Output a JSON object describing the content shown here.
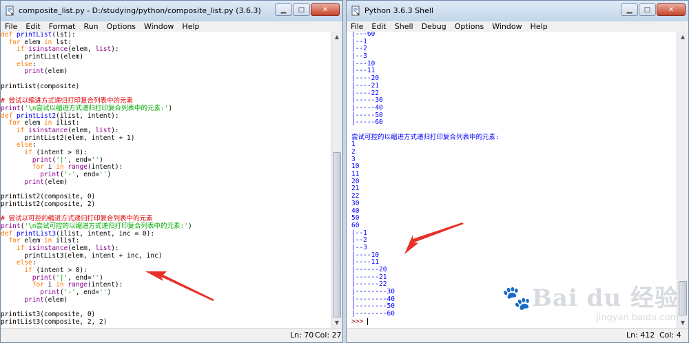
{
  "left_window": {
    "title": "composite_list.py - D:/studying/python/composite_list.py (3.6.3)",
    "menu": [
      "File",
      "Edit",
      "Format",
      "Run",
      "Options",
      "Window",
      "Help"
    ],
    "code_lines": [
      [
        [
          "kw",
          "def "
        ],
        [
          "def",
          "printList"
        ],
        [
          "",
          "(lst):"
        ]
      ],
      [
        [
          "",
          "  "
        ],
        [
          "kw",
          "for"
        ],
        [
          "",
          " elem "
        ],
        [
          "kw",
          "in"
        ],
        [
          "",
          " lst:"
        ]
      ],
      [
        [
          "",
          "    "
        ],
        [
          "kw",
          "if "
        ],
        [
          "bi",
          "isinstance"
        ],
        [
          "",
          "(elem, "
        ],
        [
          "bi",
          "list"
        ],
        [
          "",
          "):"
        ]
      ],
      [
        [
          "",
          "      printList(elem)"
        ]
      ],
      [
        [
          "",
          "    "
        ],
        [
          "kw",
          "else"
        ],
        [
          "",
          ":"
        ]
      ],
      [
        [
          "",
          "      "
        ],
        [
          "bi",
          "print"
        ],
        [
          "",
          "(elem)"
        ]
      ],
      [
        [
          "",
          ""
        ]
      ],
      [
        [
          "",
          "printList(composite)"
        ]
      ],
      [
        [
          "",
          ""
        ]
      ],
      [
        [
          "cm",
          "# 尝试以缩进方式递归打印复合列表中的元素"
        ]
      ],
      [
        [
          "bi",
          "print"
        ],
        [
          "",
          "("
        ],
        [
          "st",
          "'\\n尝试以缩进方式递归打印复合列表中的元素:'"
        ],
        [
          "",
          ")"
        ]
      ],
      [
        [
          "kw",
          "def "
        ],
        [
          "def",
          "printList2"
        ],
        [
          "",
          "(ilist, intent):"
        ]
      ],
      [
        [
          "",
          "  "
        ],
        [
          "kw",
          "for"
        ],
        [
          "",
          " elem "
        ],
        [
          "kw",
          "in"
        ],
        [
          "",
          " ilist:"
        ]
      ],
      [
        [
          "",
          "    "
        ],
        [
          "kw",
          "if "
        ],
        [
          "bi",
          "isinstance"
        ],
        [
          "",
          "(elem, "
        ],
        [
          "bi",
          "list"
        ],
        [
          "",
          "):"
        ]
      ],
      [
        [
          "",
          "      printList2(elem, intent + 1)"
        ]
      ],
      [
        [
          "",
          "    "
        ],
        [
          "kw",
          "else"
        ],
        [
          "",
          ":"
        ]
      ],
      [
        [
          "",
          "      "
        ],
        [
          "kw",
          "if"
        ],
        [
          "",
          " (intent > 0):"
        ]
      ],
      [
        [
          "",
          "        "
        ],
        [
          "bi",
          "print"
        ],
        [
          "",
          "("
        ],
        [
          "st",
          "'|'"
        ],
        [
          "",
          ", end="
        ],
        [
          "st",
          "''"
        ],
        [
          "",
          ")"
        ]
      ],
      [
        [
          "",
          "        "
        ],
        [
          "kw",
          "for"
        ],
        [
          "",
          " i "
        ],
        [
          "kw",
          "in "
        ],
        [
          "bi",
          "range"
        ],
        [
          "",
          "(intent):"
        ]
      ],
      [
        [
          "",
          "          "
        ],
        [
          "bi",
          "print"
        ],
        [
          "",
          "("
        ],
        [
          "st",
          "'-'"
        ],
        [
          "",
          ", end="
        ],
        [
          "st",
          "''"
        ],
        [
          "",
          ")"
        ]
      ],
      [
        [
          "",
          "      "
        ],
        [
          "bi",
          "print"
        ],
        [
          "",
          "(elem)"
        ]
      ],
      [
        [
          "",
          ""
        ]
      ],
      [
        [
          "",
          "printList2(composite, 0)"
        ]
      ],
      [
        [
          "",
          "printList2(composite, 2)"
        ]
      ],
      [
        [
          "",
          ""
        ]
      ],
      [
        [
          "cm",
          "# 尝试以可控的缩进方式递归打印复合列表中的元素"
        ]
      ],
      [
        [
          "bi",
          "print"
        ],
        [
          "",
          "("
        ],
        [
          "st",
          "'\\n尝试可控的以缩进方式递归打印复合列表中的元素:'"
        ],
        [
          "",
          ")"
        ]
      ],
      [
        [
          "kw",
          "def "
        ],
        [
          "def",
          "printList3"
        ],
        [
          "",
          "(ilist, intent, inc = 0):"
        ]
      ],
      [
        [
          "",
          "  "
        ],
        [
          "kw",
          "for"
        ],
        [
          "",
          " elem "
        ],
        [
          "kw",
          "in"
        ],
        [
          "",
          " ilist:"
        ]
      ],
      [
        [
          "",
          "    "
        ],
        [
          "kw",
          "if "
        ],
        [
          "bi",
          "isinstance"
        ],
        [
          "",
          "(elem, "
        ],
        [
          "bi",
          "list"
        ],
        [
          "",
          "):"
        ]
      ],
      [
        [
          "",
          "      printList3(elem, intent + inc, inc)"
        ]
      ],
      [
        [
          "",
          "    "
        ],
        [
          "kw",
          "else"
        ],
        [
          "",
          ":"
        ]
      ],
      [
        [
          "",
          "      "
        ],
        [
          "kw",
          "if"
        ],
        [
          "",
          " (intent > 0):"
        ]
      ],
      [
        [
          "",
          "        "
        ],
        [
          "bi",
          "print"
        ],
        [
          "",
          "("
        ],
        [
          "st",
          "'|'"
        ],
        [
          "",
          ", end="
        ],
        [
          "st",
          "''"
        ],
        [
          "",
          ")"
        ]
      ],
      [
        [
          "",
          "        "
        ],
        [
          "kw",
          "for"
        ],
        [
          "",
          " i "
        ],
        [
          "kw",
          "in "
        ],
        [
          "bi",
          "range"
        ],
        [
          "",
          "(intent):"
        ]
      ],
      [
        [
          "",
          "          "
        ],
        [
          "bi",
          "print"
        ],
        [
          "",
          "("
        ],
        [
          "st",
          "'-'"
        ],
        [
          "",
          ", end="
        ],
        [
          "st",
          "''"
        ],
        [
          "",
          ")"
        ]
      ],
      [
        [
          "",
          "      "
        ],
        [
          "bi",
          "print"
        ],
        [
          "",
          "(elem)"
        ]
      ],
      [
        [
          "",
          ""
        ]
      ],
      [
        [
          "",
          "printList3(composite, 0)"
        ]
      ],
      [
        [
          "",
          "printList3(composite, 2, 2)"
        ]
      ]
    ],
    "status": {
      "ln": "Ln: 70",
      "col": "Col: 27"
    }
  },
  "right_window": {
    "title": "Python 3.6.3 Shell",
    "menu": [
      "File",
      "Edit",
      "Shell",
      "Debug",
      "Options",
      "Window",
      "Help"
    ],
    "output_lines": [
      "|---60",
      "|--1",
      "|--2",
      "|--3",
      "|---10",
      "|---11",
      "|----20",
      "|----21",
      "|----22",
      "|-----30",
      "|-----40",
      "|-----50",
      "|-----60",
      "",
      "尝试可控的以缩进方式递归打印复合列表中的元素:",
      "1",
      "2",
      "3",
      "10",
      "11",
      "20",
      "21",
      "22",
      "30",
      "40",
      "50",
      "60",
      "|--1",
      "|--2",
      "|--3",
      "|----10",
      "|----11",
      "|------20",
      "|------21",
      "|------22",
      "|--------30",
      "|--------40",
      "|--------50",
      "|--------60"
    ],
    "prompt": ">>> ",
    "status": {
      "ln": "Ln: 412",
      "col": "Col: 4"
    }
  },
  "watermark": {
    "logo_text": "Bai du 经验",
    "url": "jingyan.baidu.com"
  },
  "colors": {
    "keyword": "#ff7700",
    "builtin": "#900090",
    "definition": "#0000ff",
    "comment": "#dd0000",
    "string": "#00aa00",
    "output": "#0000ff",
    "annotation_arrow": "#e8302a"
  }
}
